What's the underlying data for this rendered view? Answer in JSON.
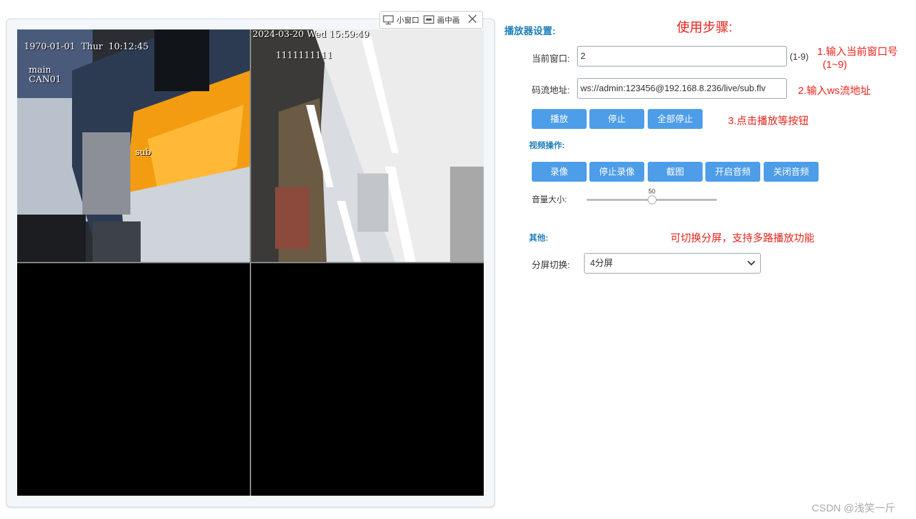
{
  "player": {
    "cells": [
      {
        "timestamp": "1970-01-01  Thur  10:12:45",
        "stream_label": "main",
        "channel": "CAN01",
        "overlay": "sub"
      },
      {
        "timestamp": "2024-03-20 Wed 15:59:49",
        "label": "1111111111"
      },
      {},
      {}
    ],
    "toolbar": {
      "small_window": "小窗口",
      "pip": "画中画"
    }
  },
  "settings": {
    "player_settings_title": "播放器设置:",
    "usage_steps_title": "使用步骤:",
    "current_window_label": "当前窗口:",
    "current_window_value": "2",
    "current_window_range": "(1-9)",
    "step1": "1.输入当前窗口号",
    "step1_range": "(1~9)",
    "stream_url_label": "码流地址:",
    "stream_url_value": "ws://admin:123456@192.168.8.236/live/sub.flv",
    "step2": "2.输入ws流地址",
    "buttons": {
      "play": "播放",
      "stop": "停止",
      "stop_all": "全部停止"
    },
    "step3": "3.点击播放等按钮",
    "video_ops_title": "视频操作:",
    "video_buttons": {
      "record": "录像",
      "stop_record": "停止录像",
      "screenshot": "截图",
      "open_audio": "开启音频",
      "close_audio": "关闭音频"
    },
    "volume_label": "音量大小:",
    "volume_value": "50",
    "volume_level": 0.5,
    "other_title": "其他:",
    "split_note": "可切换分屏，支持多路播放功能",
    "split_label": "分屏切换:",
    "split_value": "4分屏"
  },
  "watermark": "CSDN @浅笑一斤",
  "colors": {
    "accent": "#4d9de8",
    "title": "#1f7fb8",
    "annotation": "#e8231b"
  }
}
